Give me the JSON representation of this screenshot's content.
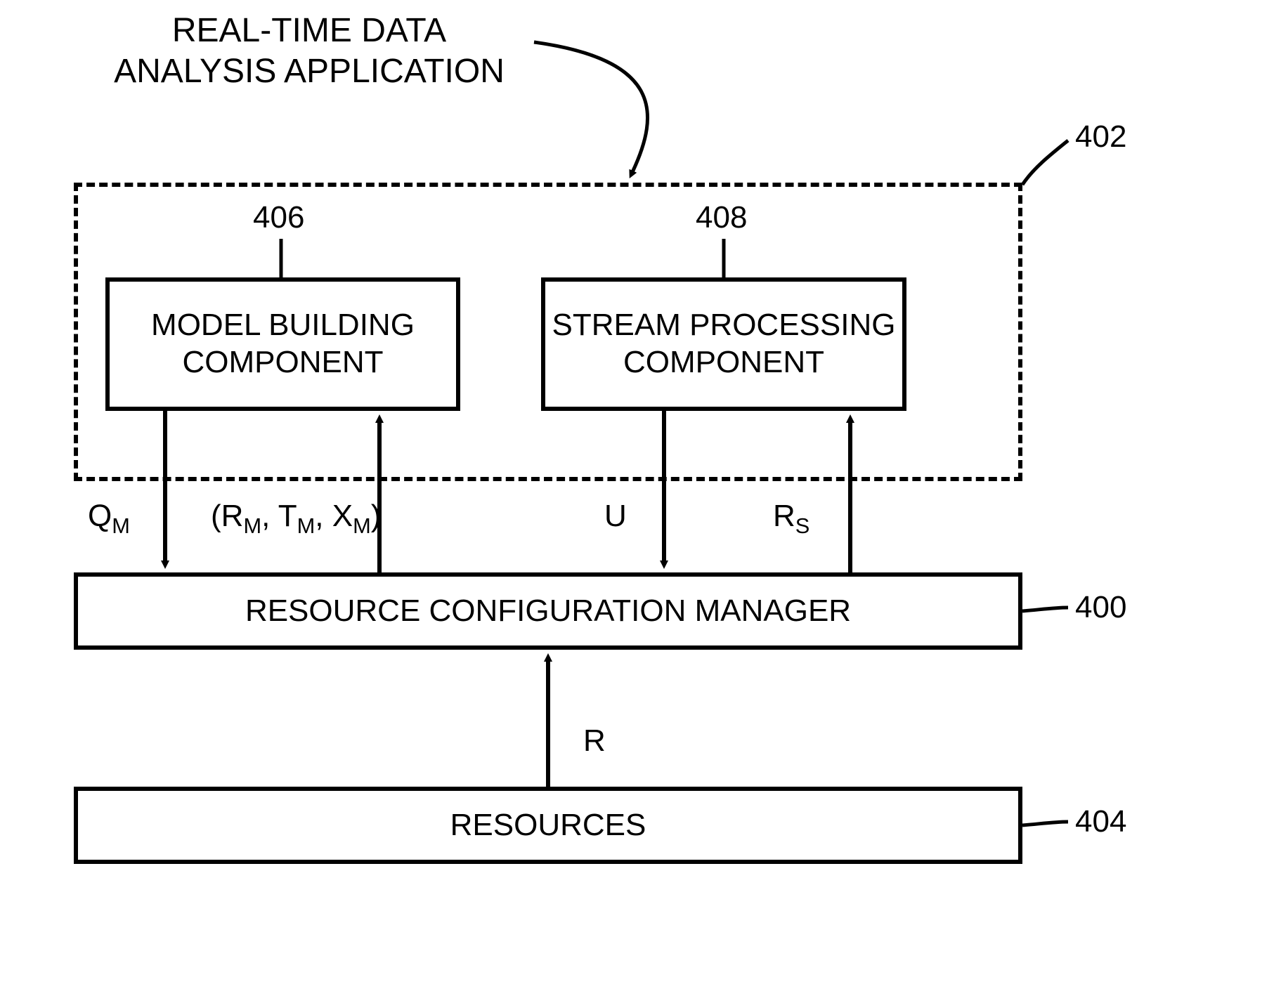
{
  "title": "REAL-TIME DATA\nANALYSIS APPLICATION",
  "boxes": {
    "model_building": "MODEL BUILDING\nCOMPONENT",
    "stream_processing": "STREAM PROCESSING\nCOMPONENT",
    "resource_config_manager": "RESOURCE CONFIGURATION MANAGER",
    "resources": "RESOURCES"
  },
  "refs": {
    "app_container": "402",
    "model_building": "406",
    "stream_processing": "408",
    "resource_config_manager": "400",
    "resources": "404"
  },
  "arrow_labels": {
    "qm": {
      "base": "Q",
      "sub": "M"
    },
    "rm_tm_xm": {
      "r": "R",
      "rsub": "M",
      "t": "T",
      "tsub": "M",
      "x": "X",
      "xsub": "M"
    },
    "u": "U",
    "rs": {
      "base": "R",
      "sub": "S"
    },
    "r": "R"
  }
}
